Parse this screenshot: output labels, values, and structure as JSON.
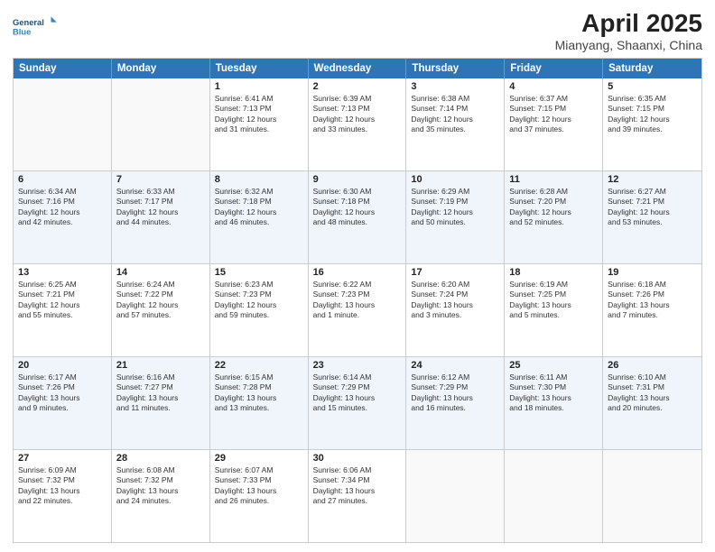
{
  "logo": {
    "line1": "General",
    "line2": "Blue"
  },
  "title": "April 2025",
  "location": "Mianyang, Shaanxi, China",
  "days_of_week": [
    "Sunday",
    "Monday",
    "Tuesday",
    "Wednesday",
    "Thursday",
    "Friday",
    "Saturday"
  ],
  "weeks": [
    [
      {
        "day": "",
        "info": ""
      },
      {
        "day": "",
        "info": ""
      },
      {
        "day": "1",
        "info": "Sunrise: 6:41 AM\nSunset: 7:13 PM\nDaylight: 12 hours\nand 31 minutes."
      },
      {
        "day": "2",
        "info": "Sunrise: 6:39 AM\nSunset: 7:13 PM\nDaylight: 12 hours\nand 33 minutes."
      },
      {
        "day": "3",
        "info": "Sunrise: 6:38 AM\nSunset: 7:14 PM\nDaylight: 12 hours\nand 35 minutes."
      },
      {
        "day": "4",
        "info": "Sunrise: 6:37 AM\nSunset: 7:15 PM\nDaylight: 12 hours\nand 37 minutes."
      },
      {
        "day": "5",
        "info": "Sunrise: 6:35 AM\nSunset: 7:15 PM\nDaylight: 12 hours\nand 39 minutes."
      }
    ],
    [
      {
        "day": "6",
        "info": "Sunrise: 6:34 AM\nSunset: 7:16 PM\nDaylight: 12 hours\nand 42 minutes."
      },
      {
        "day": "7",
        "info": "Sunrise: 6:33 AM\nSunset: 7:17 PM\nDaylight: 12 hours\nand 44 minutes."
      },
      {
        "day": "8",
        "info": "Sunrise: 6:32 AM\nSunset: 7:18 PM\nDaylight: 12 hours\nand 46 minutes."
      },
      {
        "day": "9",
        "info": "Sunrise: 6:30 AM\nSunset: 7:18 PM\nDaylight: 12 hours\nand 48 minutes."
      },
      {
        "day": "10",
        "info": "Sunrise: 6:29 AM\nSunset: 7:19 PM\nDaylight: 12 hours\nand 50 minutes."
      },
      {
        "day": "11",
        "info": "Sunrise: 6:28 AM\nSunset: 7:20 PM\nDaylight: 12 hours\nand 52 minutes."
      },
      {
        "day": "12",
        "info": "Sunrise: 6:27 AM\nSunset: 7:21 PM\nDaylight: 12 hours\nand 53 minutes."
      }
    ],
    [
      {
        "day": "13",
        "info": "Sunrise: 6:25 AM\nSunset: 7:21 PM\nDaylight: 12 hours\nand 55 minutes."
      },
      {
        "day": "14",
        "info": "Sunrise: 6:24 AM\nSunset: 7:22 PM\nDaylight: 12 hours\nand 57 minutes."
      },
      {
        "day": "15",
        "info": "Sunrise: 6:23 AM\nSunset: 7:23 PM\nDaylight: 12 hours\nand 59 minutes."
      },
      {
        "day": "16",
        "info": "Sunrise: 6:22 AM\nSunset: 7:23 PM\nDaylight: 13 hours\nand 1 minute."
      },
      {
        "day": "17",
        "info": "Sunrise: 6:20 AM\nSunset: 7:24 PM\nDaylight: 13 hours\nand 3 minutes."
      },
      {
        "day": "18",
        "info": "Sunrise: 6:19 AM\nSunset: 7:25 PM\nDaylight: 13 hours\nand 5 minutes."
      },
      {
        "day": "19",
        "info": "Sunrise: 6:18 AM\nSunset: 7:26 PM\nDaylight: 13 hours\nand 7 minutes."
      }
    ],
    [
      {
        "day": "20",
        "info": "Sunrise: 6:17 AM\nSunset: 7:26 PM\nDaylight: 13 hours\nand 9 minutes."
      },
      {
        "day": "21",
        "info": "Sunrise: 6:16 AM\nSunset: 7:27 PM\nDaylight: 13 hours\nand 11 minutes."
      },
      {
        "day": "22",
        "info": "Sunrise: 6:15 AM\nSunset: 7:28 PM\nDaylight: 13 hours\nand 13 minutes."
      },
      {
        "day": "23",
        "info": "Sunrise: 6:14 AM\nSunset: 7:29 PM\nDaylight: 13 hours\nand 15 minutes."
      },
      {
        "day": "24",
        "info": "Sunrise: 6:12 AM\nSunset: 7:29 PM\nDaylight: 13 hours\nand 16 minutes."
      },
      {
        "day": "25",
        "info": "Sunrise: 6:11 AM\nSunset: 7:30 PM\nDaylight: 13 hours\nand 18 minutes."
      },
      {
        "day": "26",
        "info": "Sunrise: 6:10 AM\nSunset: 7:31 PM\nDaylight: 13 hours\nand 20 minutes."
      }
    ],
    [
      {
        "day": "27",
        "info": "Sunrise: 6:09 AM\nSunset: 7:32 PM\nDaylight: 13 hours\nand 22 minutes."
      },
      {
        "day": "28",
        "info": "Sunrise: 6:08 AM\nSunset: 7:32 PM\nDaylight: 13 hours\nand 24 minutes."
      },
      {
        "day": "29",
        "info": "Sunrise: 6:07 AM\nSunset: 7:33 PM\nDaylight: 13 hours\nand 26 minutes."
      },
      {
        "day": "30",
        "info": "Sunrise: 6:06 AM\nSunset: 7:34 PM\nDaylight: 13 hours\nand 27 minutes."
      },
      {
        "day": "",
        "info": ""
      },
      {
        "day": "",
        "info": ""
      },
      {
        "day": "",
        "info": ""
      }
    ]
  ]
}
